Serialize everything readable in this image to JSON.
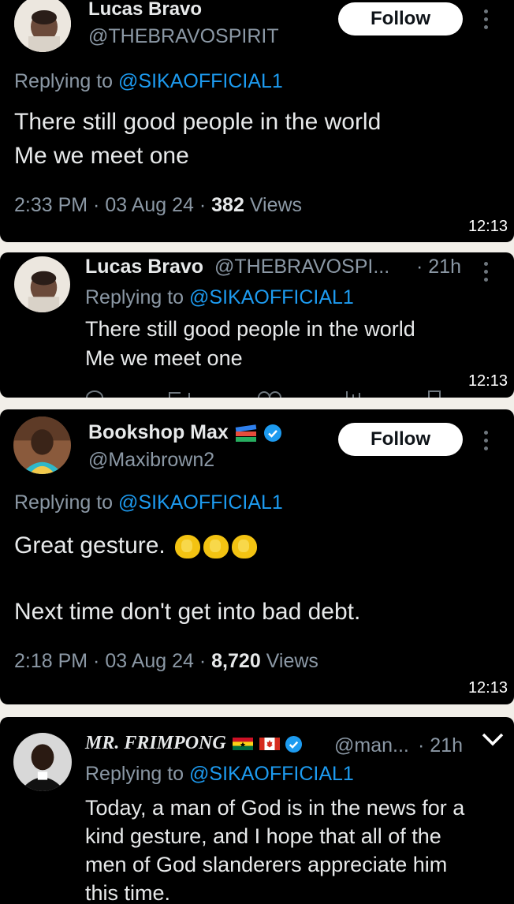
{
  "tweet1": {
    "name": "Lucas Bravo",
    "handle": "@THEBRAVOSPIRIT",
    "follow": "Follow",
    "replying_prefix": "Replying to ",
    "replying_to": "@SIKAOFFICIAL1",
    "line1": "There still good people in the world",
    "line2": "Me we meet one",
    "time": "2:33 PM · 03 Aug 24 · ",
    "views_count": "382",
    "views_label": " Views",
    "clock": "12:13"
  },
  "tweet2": {
    "name": "Lucas Bravo",
    "handle": "@THEBRAVOSPI...",
    "age": "· 21h",
    "replying_prefix": "Replying to ",
    "replying_to": "@SIKAOFFICIAL1",
    "line1": "There still good people in the world",
    "line2": "Me we meet one",
    "clock": "12:13"
  },
  "tweet3": {
    "name": "Bookshop Max",
    "handle": "@Maxibrown2",
    "follow": "Follow",
    "replying_prefix": "Replying to ",
    "replying_to": "@SIKAOFFICIAL1",
    "line1": "Great gesture.",
    "line2": "Next time don't get into bad debt.",
    "time": "2:18 PM · 03 Aug 24 · ",
    "views_count": "8,720",
    "views_label": " Views",
    "clock": "12:13"
  },
  "tweet4": {
    "name": "MR. FRIMPONG",
    "handle": "@man...",
    "age": "· 21h",
    "replying_prefix": "Replying to ",
    "replying_to": "@SIKAOFFICIAL1",
    "lines": [
      "Today, a man of God is in the news for a",
      "kind gesture, and I hope that all of the",
      "men of God slanderers appreciate him",
      "this time."
    ]
  },
  "icons": [
    "verified-badge-icon",
    "more-options-icon",
    "books-emoji-icon",
    "clapping-hands-emoji-icon",
    "ghana-flag-icon",
    "canada-flag-icon",
    "chevron-down-icon"
  ],
  "colors": {
    "background": "#000000",
    "link": "#1d9bf0",
    "muted": "#8b98a5",
    "text": "#e7e9ea",
    "follow_bg": "#ffffff"
  }
}
